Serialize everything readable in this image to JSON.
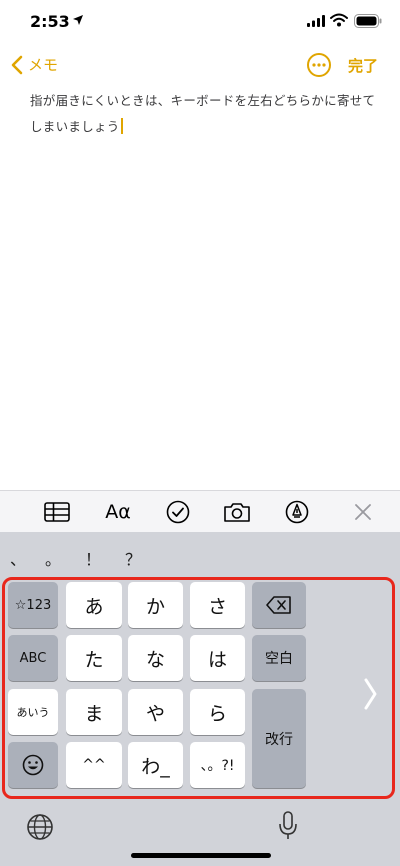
{
  "status_bar": {
    "time": "2:53"
  },
  "nav": {
    "back_label": "メモ",
    "done_label": "完了"
  },
  "note": {
    "text": "指が届きにくいときは、キーボードを左右どちらかに寄せてしまいましょう"
  },
  "toolbar": {
    "format_label": "Aα"
  },
  "candidates": [
    "、",
    "。",
    "！",
    "？"
  ],
  "keys": {
    "row1": [
      "☆123",
      "あ",
      "か",
      "さ"
    ],
    "row2": [
      "ABC",
      "た",
      "な",
      "は",
      "空白"
    ],
    "row3": [
      "あいう",
      "ま",
      "や",
      "ら",
      "改行"
    ],
    "row4": [
      "^^",
      "わ_",
      "、。?!"
    ]
  },
  "icons": {
    "back": "chevron-left-icon",
    "more": "ellipsis-circle-icon",
    "table": "table-icon",
    "checklist": "checkmark-circle-icon",
    "camera": "camera-icon",
    "markup": "pen-circle-icon",
    "close": "close-icon",
    "delete": "delete-backspace-icon",
    "emoji": "emoji-icon",
    "globe": "globe-icon",
    "mic": "microphone-icon",
    "next": "chevron-right-icon"
  },
  "colors": {
    "accent": "#e0a500",
    "highlight": "#e8271c",
    "keyboard_bg": "#d1d3d9"
  }
}
